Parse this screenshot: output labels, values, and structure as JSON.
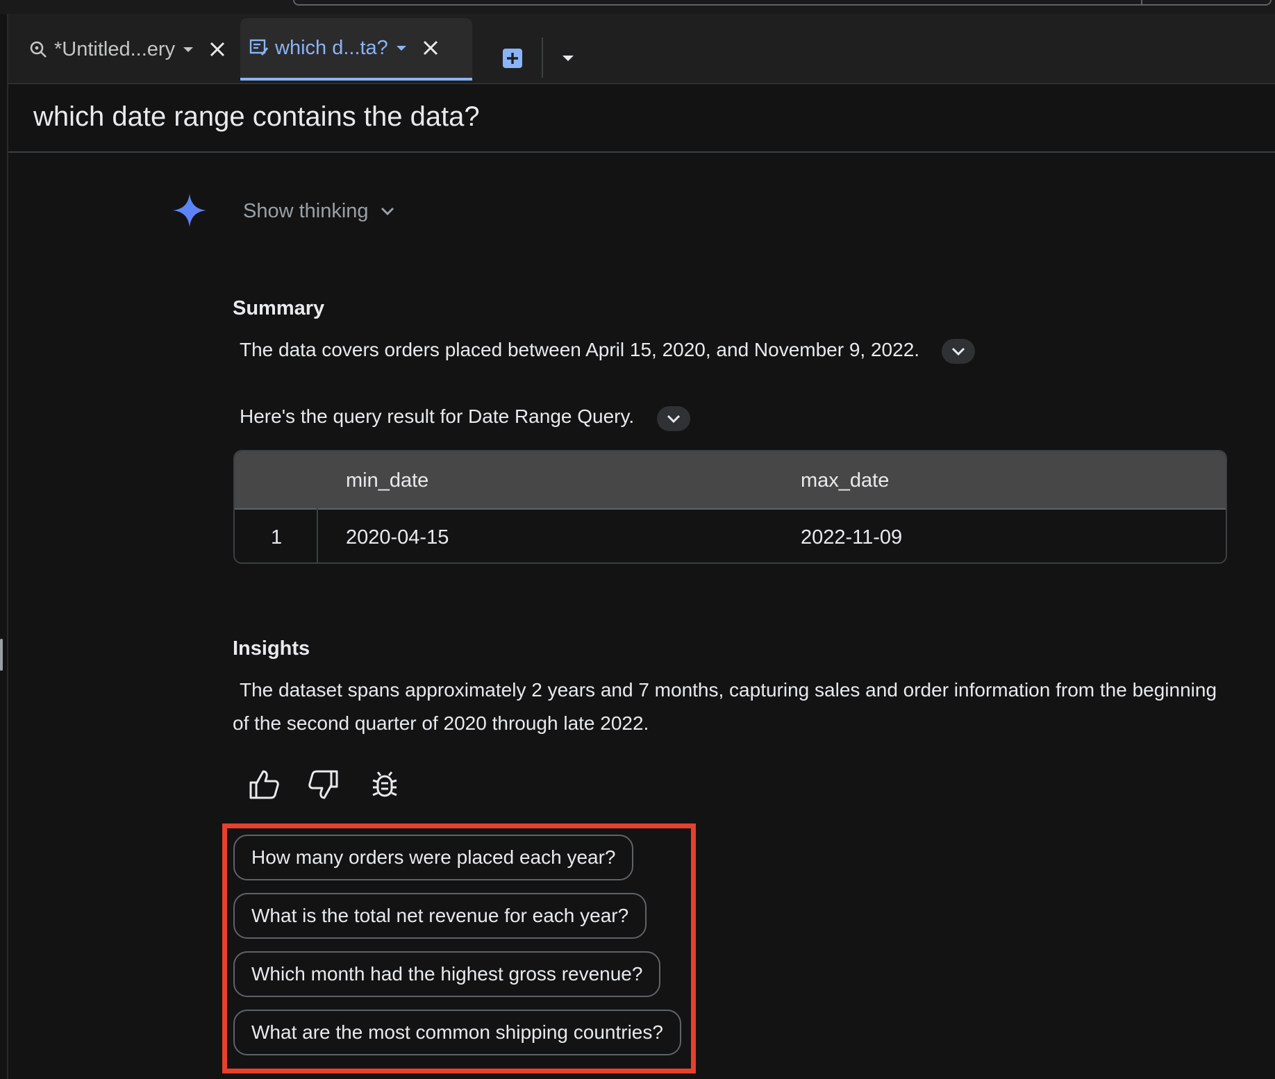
{
  "tabs": [
    {
      "label": "*Untitled...ery",
      "icon": "query-search-icon",
      "active": false
    },
    {
      "label": "which d...ta?",
      "icon": "chat-edit-icon",
      "active": true
    }
  ],
  "page_title": "which date range contains the data?",
  "show_thinking_label": "Show thinking",
  "summary": {
    "heading": "Summary",
    "text": "The data covers orders placed between April 15, 2020, and November 9, 2022.",
    "query_text": "Here's the query result for Date Range Query."
  },
  "result_table": {
    "columns": [
      "",
      "min_date",
      "max_date"
    ],
    "rows": [
      [
        "1",
        "2020-04-15",
        "2022-11-09"
      ]
    ]
  },
  "insights": {
    "heading": "Insights",
    "text": "The dataset spans approximately 2 years and 7 months, capturing sales and order information from the beginning of the second quarter of 2020 through late 2022."
  },
  "suggestions": [
    "How many orders were placed each year?",
    "What is the total net revenue for each year?",
    "Which month had the highest gross revenue?",
    "What are the most common shipping countries?"
  ],
  "colors": {
    "accent": "#8ab4f8",
    "highlight_box": "#e8402d",
    "background": "#131313"
  }
}
